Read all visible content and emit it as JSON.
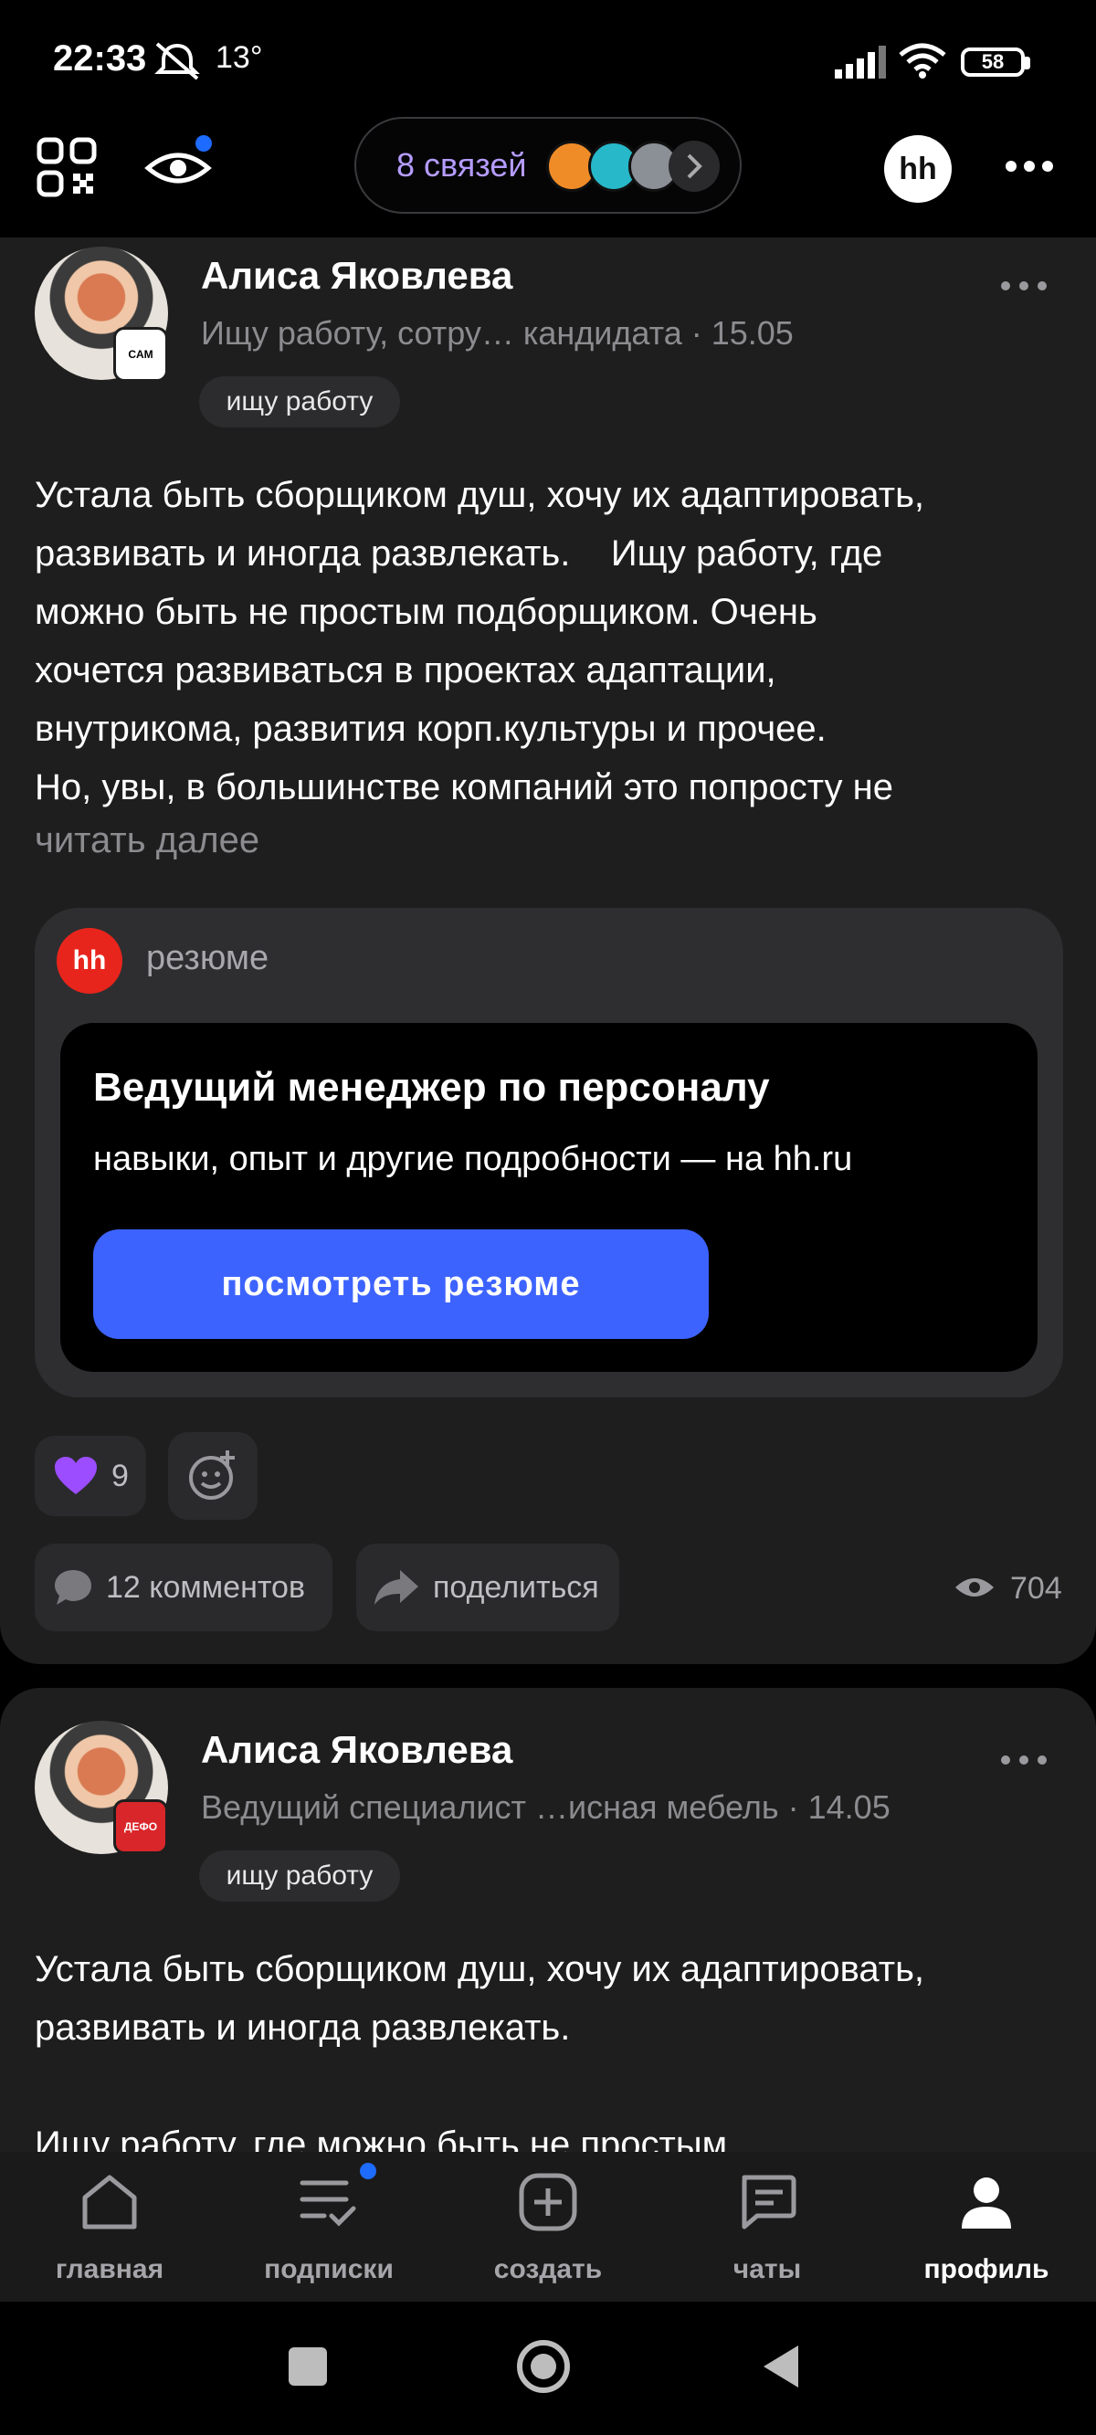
{
  "status_bar": {
    "time": "22:33",
    "temperature": "13°",
    "battery": "58"
  },
  "top_bar": {
    "connections_label": "8 связей",
    "hh_badge": "hh"
  },
  "posts": [
    {
      "author": "Алиса Яковлева",
      "subtitle": "Ищу работу, сотру… кандидата · 15.05",
      "badge_text": "CAM",
      "status_chip": "ищу работу",
      "text": "Устала быть сборщиком душ, хочу их адаптировать,\nразвивать и иногда развлекать.    Ищу работу, где\nможно быть не простым подборщиком. Очень\nхочется развиваться в проектах адаптации,\nвнутрикома, развития корп.культуры и прочее.\nНо, увы, в большинстве компаний это попросту не",
      "read_more": "читать далее",
      "attachment": {
        "logo": "hh",
        "label": "резюме",
        "title": "Ведущий менеджер по персоналу",
        "description": "навыки, опыт и другие подробности — на hh.ru",
        "button": "посмотреть резюме"
      },
      "reaction_count": "9",
      "comments_label": "12 комментов",
      "share_label": "поделиться",
      "views": "704"
    },
    {
      "author": "Алиса Яковлева",
      "subtitle": "Ведущий специалист …исная мебель · 14.05",
      "badge_text": "ДЕФО",
      "status_chip": "ищу работу",
      "text": "Устала быть сборщиком душ, хочу их адаптировать,\nразвивать и иногда развлекать.\n\nИщу работу, где можно быть не простым"
    }
  ],
  "bottom_nav": [
    {
      "label": "главная",
      "icon": "home-icon"
    },
    {
      "label": "подписки",
      "icon": "subscriptions-icon"
    },
    {
      "label": "создать",
      "icon": "create-plus-icon"
    },
    {
      "label": "чаты",
      "icon": "chat-icon"
    },
    {
      "label": "профиль",
      "icon": "profile-icon"
    }
  ],
  "colors": {
    "accent_blue": "#3d63ff",
    "hh_red": "#e8251c",
    "connections_purple": "#b59cff"
  }
}
